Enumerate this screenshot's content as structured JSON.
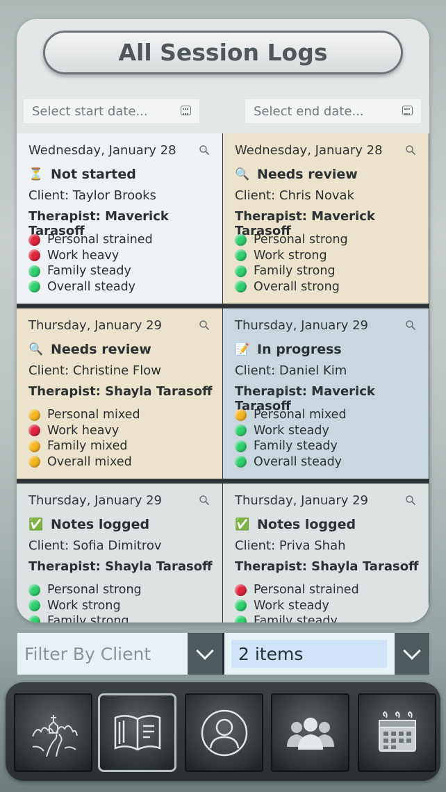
{
  "header": {
    "title": "All Session Logs"
  },
  "date_filter": {
    "start_placeholder": "Select start date...",
    "end_placeholder": "Select end date..."
  },
  "sessions": [
    {
      "date": "Wednesday, January 28",
      "status": "Not started",
      "status_icon": "hourglass-icon",
      "client": "Client: Taylor Brooks",
      "therapist": "Therapist: Maverick Tarasoff",
      "bg": "#eef2f4",
      "metrics": [
        {
          "label": "Personal strained",
          "color": "#e0243c"
        },
        {
          "label": "Work heavy",
          "color": "#e0243c"
        },
        {
          "label": "Family steady",
          "color": "#2fd06e"
        },
        {
          "label": "Overall steady",
          "color": "#2fd06e"
        }
      ]
    },
    {
      "date": "Wednesday, January 28",
      "status": "Needs review",
      "status_icon": "magnifier-icon",
      "client": "Client: Chris Novak",
      "therapist": "Therapist: Maverick Tarasoff",
      "bg": "#ebe3cb",
      "metrics": [
        {
          "label": "Personal strong",
          "color": "#2fd06e"
        },
        {
          "label": "Work strong",
          "color": "#2fd06e"
        },
        {
          "label": "Family strong",
          "color": "#2fd06e"
        },
        {
          "label": "Overall strong",
          "color": "#2fd06e"
        }
      ]
    },
    {
      "date": "Thursday, January 29",
      "status": "Needs review",
      "status_icon": "magnifier-icon",
      "client": "Client: Christine Flow",
      "therapist": "Therapist: Shayla Tarasoff",
      "bg": "#ebe3cb",
      "metrics": [
        {
          "label": "Personal mixed",
          "color": "#f5b622"
        },
        {
          "label": "Work heavy",
          "color": "#e0243c"
        },
        {
          "label": "Family mixed",
          "color": "#f5b622"
        },
        {
          "label": "Overall mixed",
          "color": "#f5b622"
        }
      ]
    },
    {
      "date": "Thursday, January 29",
      "status": "In progress",
      "status_icon": "memo-icon",
      "client": "Client: Daniel Kim",
      "therapist": "Therapist: Maverick Tarasoff",
      "bg": "#cbd7de",
      "metrics": [
        {
          "label": "Personal mixed",
          "color": "#f5b622"
        },
        {
          "label": "Work steady",
          "color": "#2fd06e"
        },
        {
          "label": "Family steady",
          "color": "#2fd06e"
        },
        {
          "label": "Overall steady",
          "color": "#2fd06e"
        }
      ]
    },
    {
      "date": "Thursday, January 29",
      "status": "Notes logged",
      "status_icon": "check-box-icon",
      "client": "Client: Sofia Dimitrov",
      "therapist": "Therapist: Shayla Tarasoff",
      "bg": "#dde3e2",
      "metrics": [
        {
          "label": "Personal strong",
          "color": "#2fd06e"
        },
        {
          "label": "Work strong",
          "color": "#2fd06e"
        },
        {
          "label": "Family strong",
          "color": "#2fd06e"
        }
      ]
    },
    {
      "date": "Thursday, January 29",
      "status": "Notes logged",
      "status_icon": "check-box-icon",
      "client": "Client: Priva Shah",
      "therapist": "Therapist: Shayla Tarasoff",
      "bg": "#dde3e2",
      "metrics": [
        {
          "label": "Personal strained",
          "color": "#e0243c"
        },
        {
          "label": "Work steady",
          "color": "#2fd06e"
        },
        {
          "label": "Family steady",
          "color": "#2fd06e"
        }
      ]
    }
  ],
  "filters": {
    "client_placeholder": "Filter By Client",
    "items_label": "2 items"
  },
  "dock": [
    {
      "name": "journey-path-icon",
      "active": false
    },
    {
      "name": "open-book-icon",
      "active": true
    },
    {
      "name": "profile-icon",
      "active": false
    },
    {
      "name": "group-icon",
      "active": false
    },
    {
      "name": "calendar-icon",
      "active": false
    }
  ]
}
